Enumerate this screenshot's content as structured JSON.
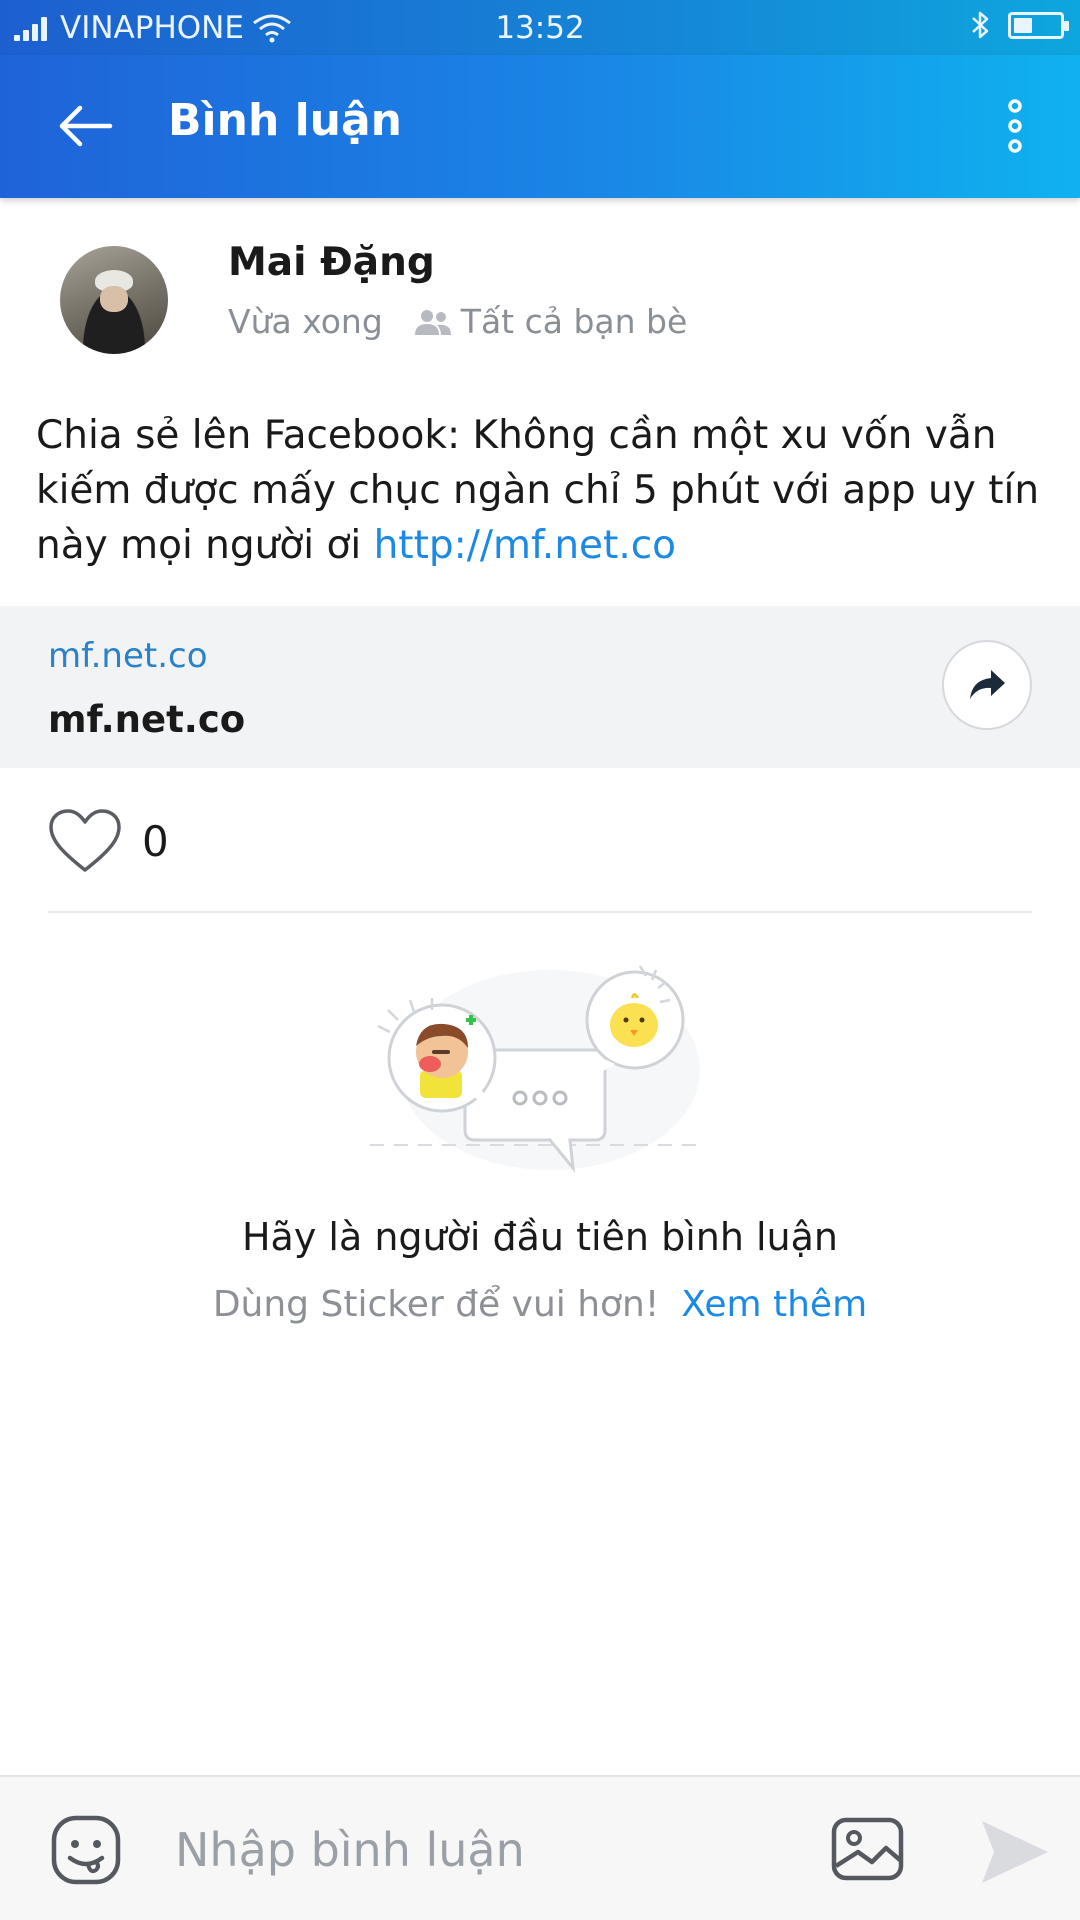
{
  "status_bar": {
    "carrier": "VINAPHONE",
    "time": "13:52",
    "icons": [
      "signal-icon",
      "wifi-icon",
      "bluetooth-icon",
      "battery-icon"
    ],
    "battery_level": 0.35
  },
  "app_bar": {
    "title": "Bình luận",
    "icons": {
      "back": "arrow-left-icon",
      "more": "more-vertical-icon"
    }
  },
  "post": {
    "author": "Mai Đặng",
    "time": "Vừa xong",
    "privacy": "Tất cả bạn bè",
    "text": "Chia sẻ lên Facebook: Không cần một xu vốn vẫn kiếm được mấy chục ngàn chỉ 5 phút với app uy tín này mọi người ơi ",
    "link_text": "http://mf.net.co",
    "preview": {
      "domain": "mf.net.co",
      "title": "mf.net.co"
    },
    "likes": "0"
  },
  "empty_state": {
    "title": "Hãy là người đầu tiên bình luận",
    "subtitle": "Dùng Sticker để vui hơn!",
    "more_link": "Xem thêm"
  },
  "input_bar": {
    "placeholder": "Nhập bình luận",
    "value": ""
  },
  "colors": {
    "header_start": "#1f63d8",
    "header_end": "#0fb2ee",
    "link": "#1c8ae5",
    "muted": "#8a8f96"
  }
}
